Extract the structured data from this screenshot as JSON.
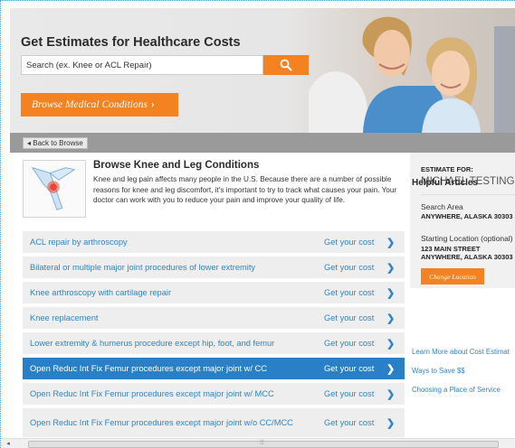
{
  "header": {
    "title": "Get Estimates for Healthcare Costs",
    "search_placeholder": "Search (ex. Knee or ACL Repair)",
    "browse_button": "Browse Medical Conditions",
    "browse_chevron": "›"
  },
  "backbar": {
    "back_label": "◂ Back to Browse"
  },
  "intro": {
    "title": "Browse Knee and Leg Conditions",
    "description": "Knee and leg pain affects many people in the U.S. Because there are a number of possible reasons for knee and leg discomfort, it's important to try to track what causes your pain. Your doctor can work with you to reduce your pain and improve your quality of life."
  },
  "procedures": [
    {
      "label": "ACL repair by arthroscopy",
      "cost": "Get your cost",
      "arrow": "❯"
    },
    {
      "label": "Bilateral or multiple major joint procedures of lower extremity",
      "cost": "Get your cost",
      "arrow": "❯"
    },
    {
      "label": "Knee arthroscopy with cartilage repair",
      "cost": "Get your cost",
      "arrow": "❯"
    },
    {
      "label": "Knee replacement",
      "cost": "Get your cost",
      "arrow": "❯"
    },
    {
      "label": "Lower extremity & humerus procedure except hip, foot, and femur",
      "cost": "Get your cost",
      "arrow": "❯"
    },
    {
      "label": "Open Reduc Int Fix Femur procedures except major joint w/ CC",
      "cost": "Get your cost",
      "arrow": "❯",
      "selected": true
    },
    {
      "label": "Open Reduc Int Fix Femur procedures except major joint w/ MCC",
      "cost": "Get your cost",
      "arrow": "❯"
    },
    {
      "label": "Open Reduc Int Fix Femur procedures except major joint w/o CC/MCC",
      "cost": "Get your cost",
      "arrow": "❯"
    }
  ],
  "estimate": {
    "label": "ESTIMATE FOR:",
    "name": "MICHAEL TESTING",
    "search_area_label": "Search Area",
    "search_area_value": "ANYWHERE, ALASKA 30303",
    "start_label": "Starting Location (optional)",
    "start_line1": "123 MAIN STREET",
    "start_line2": "ANYWHERE, ALASKA 30303",
    "change_button": "Change Location"
  },
  "helpful": {
    "title": "Helpful Articles",
    "links": [
      "Learn More about Cost Estimat",
      "Ways to Save $$",
      "Choosing a Place of Service"
    ]
  },
  "scrollbar": {
    "left_arrow": "◂",
    "grip": "⦙⦙⦙"
  },
  "colors": {
    "accent": "#f58220",
    "link": "#2f84c8",
    "selected_row": "#2a80c6",
    "backbar": "#9a9a9a"
  },
  "icons": {
    "search": "search-icon",
    "back": "back-arrow-icon",
    "row_arrow": "chevron-right-icon"
  }
}
